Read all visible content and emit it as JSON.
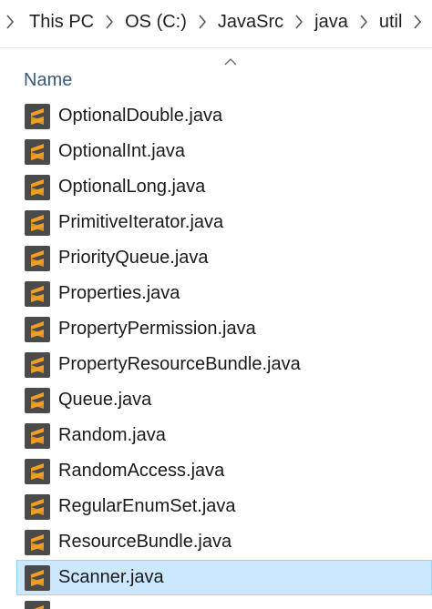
{
  "breadcrumb": {
    "items": [
      {
        "label": "This PC"
      },
      {
        "label": "OS (C:)"
      },
      {
        "label": "JavaSrc"
      },
      {
        "label": "java"
      },
      {
        "label": "util"
      }
    ]
  },
  "columns": {
    "name_header": "Name",
    "sort": "ascending"
  },
  "icons": {
    "file_icon": "sublime-text-icon",
    "chevron": "chevron-right-icon",
    "sort": "sort-ascending-icon"
  },
  "colors": {
    "icon_bg": "#4a4a4a",
    "icon_accent": "#f29d25",
    "selection_bg": "#cce8ff",
    "selection_border": "#99d1ff",
    "header_text": "#3b5a7a"
  },
  "files": [
    {
      "name": "OptionalDouble.java",
      "selected": false
    },
    {
      "name": "OptionalInt.java",
      "selected": false
    },
    {
      "name": "OptionalLong.java",
      "selected": false
    },
    {
      "name": "PrimitiveIterator.java",
      "selected": false
    },
    {
      "name": "PriorityQueue.java",
      "selected": false
    },
    {
      "name": "Properties.java",
      "selected": false
    },
    {
      "name": "PropertyPermission.java",
      "selected": false
    },
    {
      "name": "PropertyResourceBundle.java",
      "selected": false
    },
    {
      "name": "Queue.java",
      "selected": false
    },
    {
      "name": "Random.java",
      "selected": false
    },
    {
      "name": "RandomAccess.java",
      "selected": false
    },
    {
      "name": "RegularEnumSet.java",
      "selected": false
    },
    {
      "name": "ResourceBundle.java",
      "selected": false
    },
    {
      "name": "Scanner.java",
      "selected": true
    }
  ]
}
